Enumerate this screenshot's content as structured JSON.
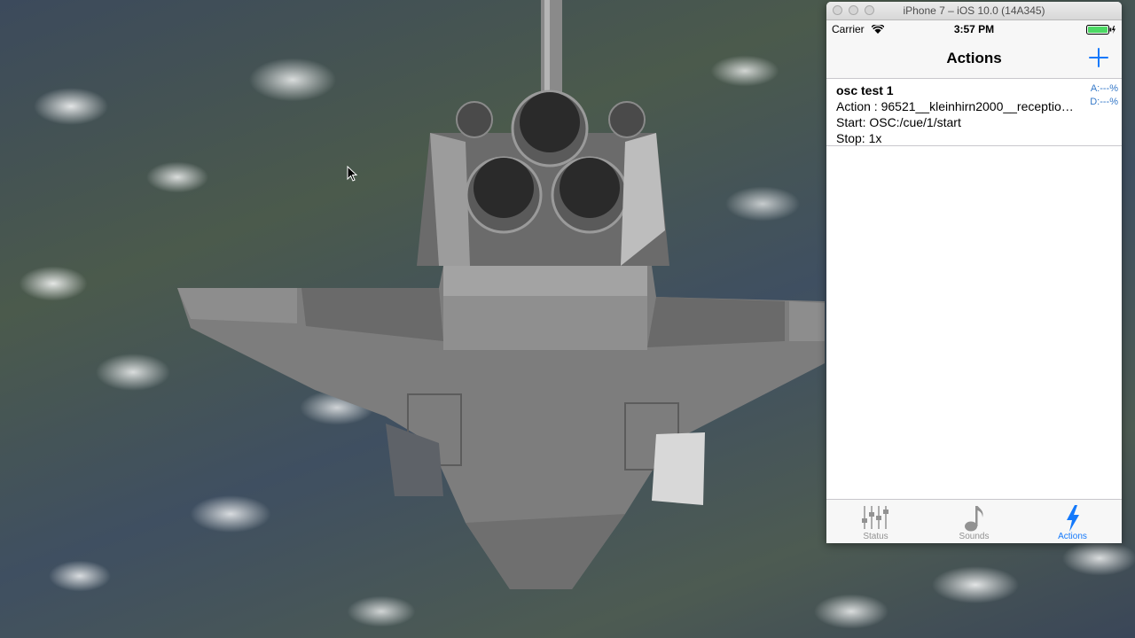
{
  "simulator": {
    "window_title": "iPhone 7 – iOS 10.0 (14A345)"
  },
  "status_bar": {
    "carrier": "Carrier",
    "time": "3:57 PM"
  },
  "nav": {
    "title": "Actions"
  },
  "actions": [
    {
      "name": "osc test 1",
      "action": "Action : 96521__kleinhirn2000__reception-bell.wav",
      "start": "Start: OSC:/cue/1/start",
      "stop": "Stop: 1x",
      "meta_a": "A:---%",
      "meta_d": "D:---%"
    }
  ],
  "tabs": [
    {
      "label": "Status",
      "icon": "mixer-sliders-icon",
      "active": false
    },
    {
      "label": "Sounds",
      "icon": "music-note-icon",
      "active": false
    },
    {
      "label": "Actions",
      "icon": "lightning-bolt-icon",
      "active": true
    }
  ],
  "colors": {
    "accent": "#1479fb",
    "inactive_tab": "#929292",
    "battery": "#4cd964"
  }
}
